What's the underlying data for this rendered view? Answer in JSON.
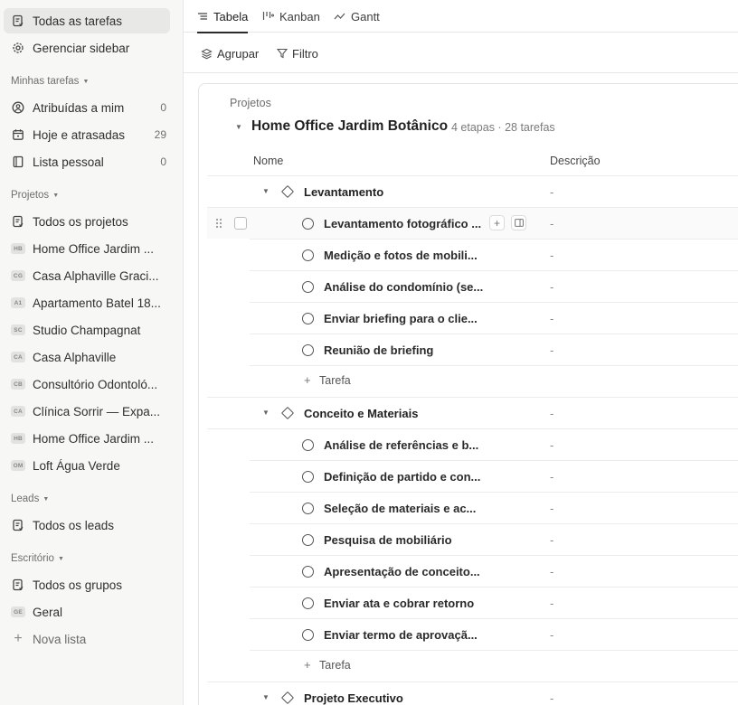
{
  "sidebar": {
    "top": [
      {
        "label": "Todas as tarefas",
        "icon": "task-list-icon"
      },
      {
        "label": "Gerenciar sidebar",
        "icon": "gear-icon"
      }
    ],
    "my_tasks": {
      "title": "Minhas tarefas",
      "items": [
        {
          "label": "Atribuídas a mim",
          "count": "0",
          "icon": "user-circle-icon"
        },
        {
          "label": "Hoje e atrasadas",
          "count": "29",
          "icon": "calendar-icon"
        },
        {
          "label": "Lista pessoal",
          "count": "0",
          "icon": "notebook-icon"
        }
      ]
    },
    "projects": {
      "title": "Projetos",
      "all": "Todos os projetos",
      "items": [
        {
          "badge": "HB",
          "label": "Home Office Jardim ..."
        },
        {
          "badge": "CG",
          "label": "Casa Alphaville Graci..."
        },
        {
          "badge": "A1",
          "label": "Apartamento Batel 18..."
        },
        {
          "badge": "SC",
          "label": "Studio Champagnat"
        },
        {
          "badge": "CA",
          "label": "Casa Alphaville"
        },
        {
          "badge": "CB",
          "label": "Consultório Odontoló..."
        },
        {
          "badge": "CA",
          "label": "Clínica Sorrir — Expa..."
        },
        {
          "badge": "HB",
          "label": "Home Office Jardim ..."
        },
        {
          "badge": "OM",
          "label": "Loft Água Verde"
        }
      ]
    },
    "leads": {
      "title": "Leads",
      "all": "Todos os leads"
    },
    "office": {
      "title": "Escritório",
      "all": "Todos os grupos",
      "general": {
        "badge": "GE",
        "label": "Geral"
      },
      "new_list": "Nova lista"
    }
  },
  "tabs": [
    {
      "label": "Tabela",
      "icon": "list-icon",
      "active": true
    },
    {
      "label": "Kanban",
      "icon": "kanban-icon",
      "active": false
    },
    {
      "label": "Gantt",
      "icon": "gantt-icon",
      "active": false
    }
  ],
  "toolbar": {
    "group_label": "Agrupar",
    "filter_label": "Filtro"
  },
  "project": {
    "breadcrumb": "Projetos",
    "title": "Home Office Jardim Botânico",
    "meta": "4 etapas · 28 tarefas"
  },
  "columns": {
    "name": "Nome",
    "description": "Descrição"
  },
  "stages": [
    {
      "name": "Levantamento",
      "desc": "-",
      "tasks": [
        {
          "name": "Levantamento fotográfico ...",
          "desc": "-"
        },
        {
          "name": "Medição e fotos de mobili...",
          "desc": "-"
        },
        {
          "name": "Análise do condomínio (se...",
          "desc": "-"
        },
        {
          "name": "Enviar briefing para o clie...",
          "desc": "-"
        },
        {
          "name": "Reunião de briefing",
          "desc": "-"
        }
      ],
      "add_label": "Tarefa"
    },
    {
      "name": "Conceito e Materiais",
      "desc": "-",
      "tasks": [
        {
          "name": "Análise de referências e b...",
          "desc": "-"
        },
        {
          "name": "Definição de partido e con...",
          "desc": "-"
        },
        {
          "name": "Seleção de materiais e ac...",
          "desc": "-"
        },
        {
          "name": "Pesquisa de mobiliário",
          "desc": "-"
        },
        {
          "name": "Apresentação de conceito...",
          "desc": "-"
        },
        {
          "name": "Enviar ata e cobrar retorno",
          "desc": "-"
        },
        {
          "name": "Enviar termo de aprovaçã...",
          "desc": "-"
        }
      ],
      "add_label": "Tarefa"
    },
    {
      "name": "Projeto Executivo",
      "desc": "-",
      "tasks": []
    }
  ]
}
